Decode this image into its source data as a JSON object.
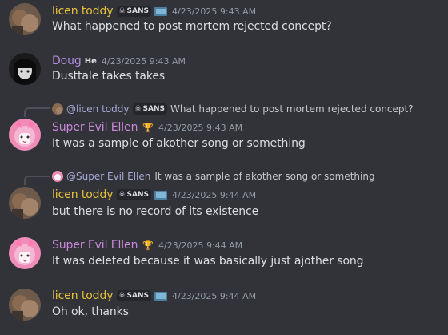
{
  "users": {
    "licen": {
      "name": "licen toddy",
      "color": "#e8c13a",
      "tag": "SANS"
    },
    "doug": {
      "name": "Doug",
      "color": "#b28ddd",
      "badge": "He"
    },
    "ellen": {
      "name": "Super Evil Ellen",
      "color": "#c789d8"
    }
  },
  "messages": [
    {
      "author": "licen toddy",
      "tag": "SANS",
      "time": "4/23/2025 9:43 AM",
      "text": "What happened to post mortem rejected concept?"
    },
    {
      "author": "Doug",
      "badge": "He",
      "time": "4/23/2025 9:43 AM",
      "text": "Dusttale takes takes"
    },
    {
      "reply_to": {
        "name": "@licen toddy",
        "tag": "SANS",
        "text": "What happened to post mortem rejected concept?"
      },
      "author": "Super Evil Ellen",
      "time": "4/23/2025 9:43 AM",
      "text": "It was a sample of akother song or something"
    },
    {
      "reply_to": {
        "name": "@Super Evil Ellen",
        "text": "It was a sample of akother song or something"
      },
      "author": "licen toddy",
      "tag": "SANS",
      "time": "4/23/2025 9:44 AM",
      "text": "but there is no record of its existence"
    },
    {
      "author": "Super Evil Ellen",
      "time": "4/23/2025 9:44 AM",
      "text": "It was deleted because it was basically just ajother song"
    },
    {
      "author": "licen toddy",
      "tag": "SANS",
      "time": "4/23/2025 9:44 AM",
      "text": "Oh ok, thanks"
    }
  ]
}
